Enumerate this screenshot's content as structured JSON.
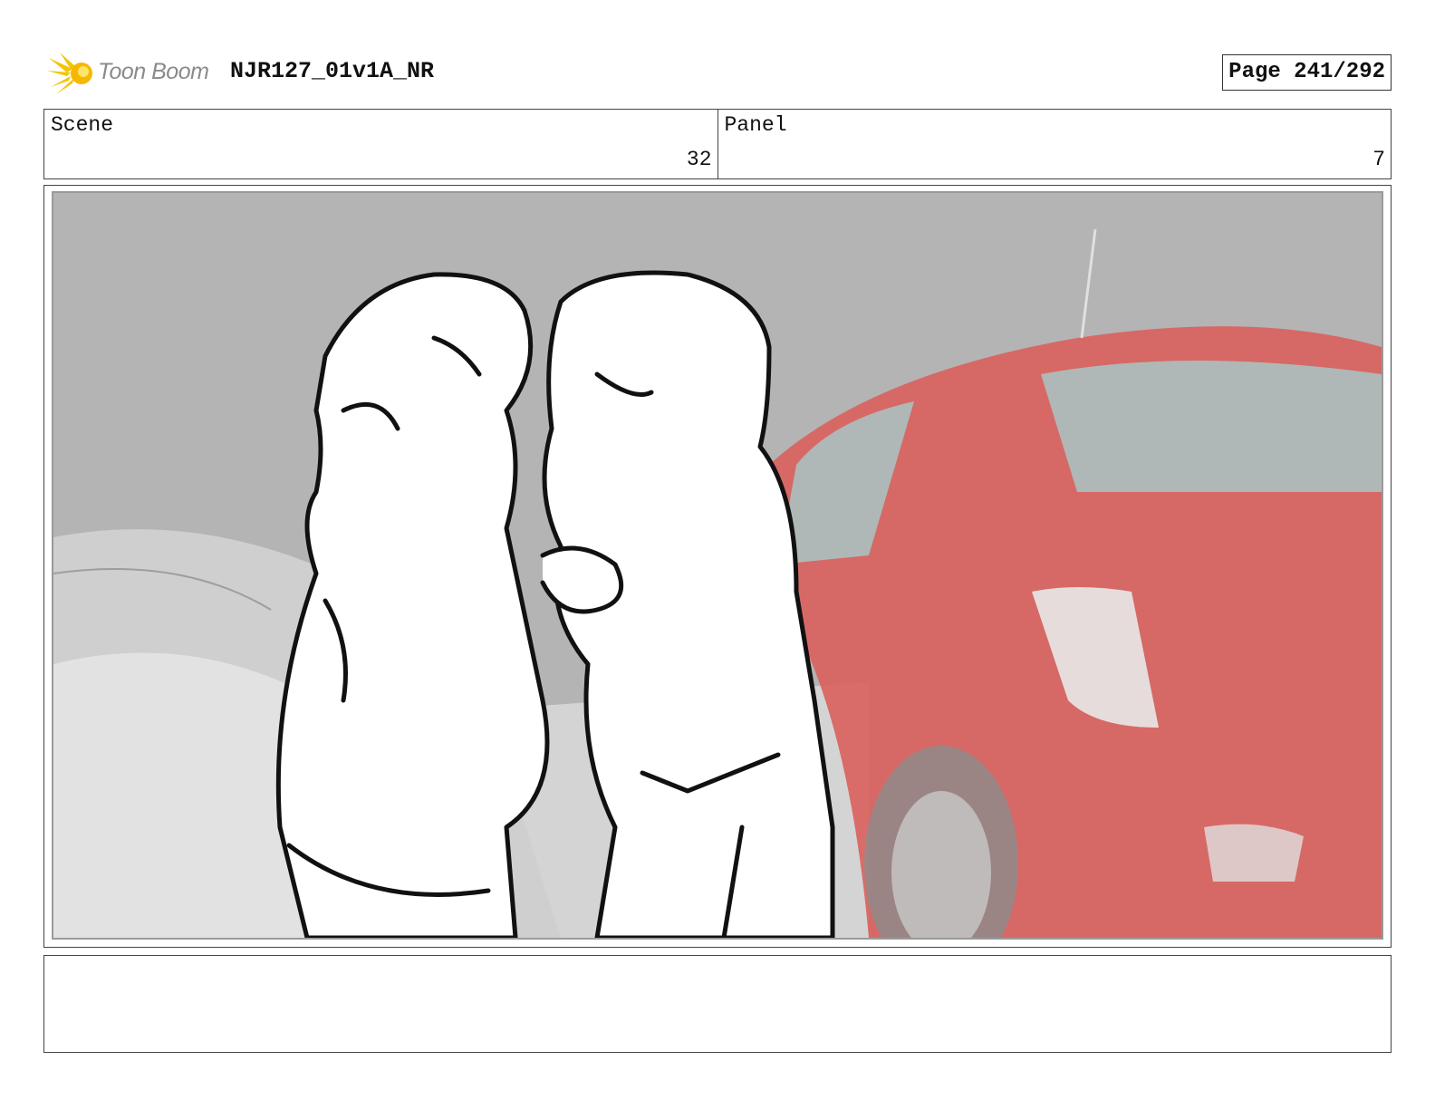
{
  "header": {
    "logo_text": "Toon Boom",
    "document_title": "NJR127_01v1A_NR",
    "page_label": "Page 241/292"
  },
  "info": {
    "scene_label": "Scene",
    "scene_value": "32",
    "panel_label": "Panel",
    "panel_value": "7"
  },
  "panel": {
    "image_icon": "storyboard-sketch-image"
  },
  "notes": {
    "text": ""
  },
  "colors": {
    "logo_accent": "#f5c400",
    "car_red": "#d9605c",
    "car_glass": "#a9c6c6",
    "background_gray": "#b6b6b6"
  }
}
